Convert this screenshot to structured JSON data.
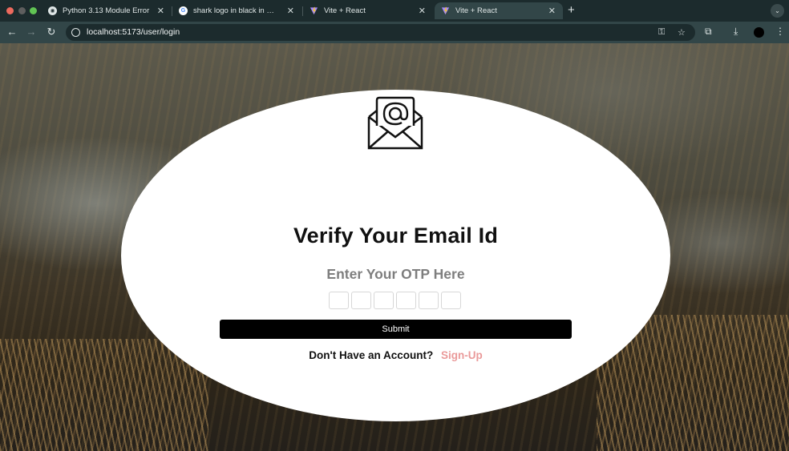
{
  "browser": {
    "tabs": [
      {
        "label": "Python 3.13 Module Error",
        "icon": "chatgpt-icon",
        "active": false
      },
      {
        "label": "shark logo in black in side po",
        "icon": "google-icon",
        "active": false
      },
      {
        "label": "Vite + React",
        "icon": "vite-icon",
        "active": false
      },
      {
        "label": "Vite + React",
        "icon": "vite-icon",
        "active": true
      }
    ],
    "new_tab_label": "+",
    "url": "localhost:5173/user/login"
  },
  "verify": {
    "icon": "envelope-at-icon",
    "title": "Verify Your Email Id",
    "subtitle": "Enter Your OTP Here",
    "otp_values": [
      "",
      "",
      "",
      "",
      "",
      ""
    ],
    "submit_label": "Submit",
    "signup_prompt": "Don't Have an Account?",
    "signup_link": "Sign-Up"
  },
  "colors": {
    "submit_bg": "#000000",
    "signup_link": "#ea9a9a",
    "subtitle": "#7e7e7e"
  }
}
